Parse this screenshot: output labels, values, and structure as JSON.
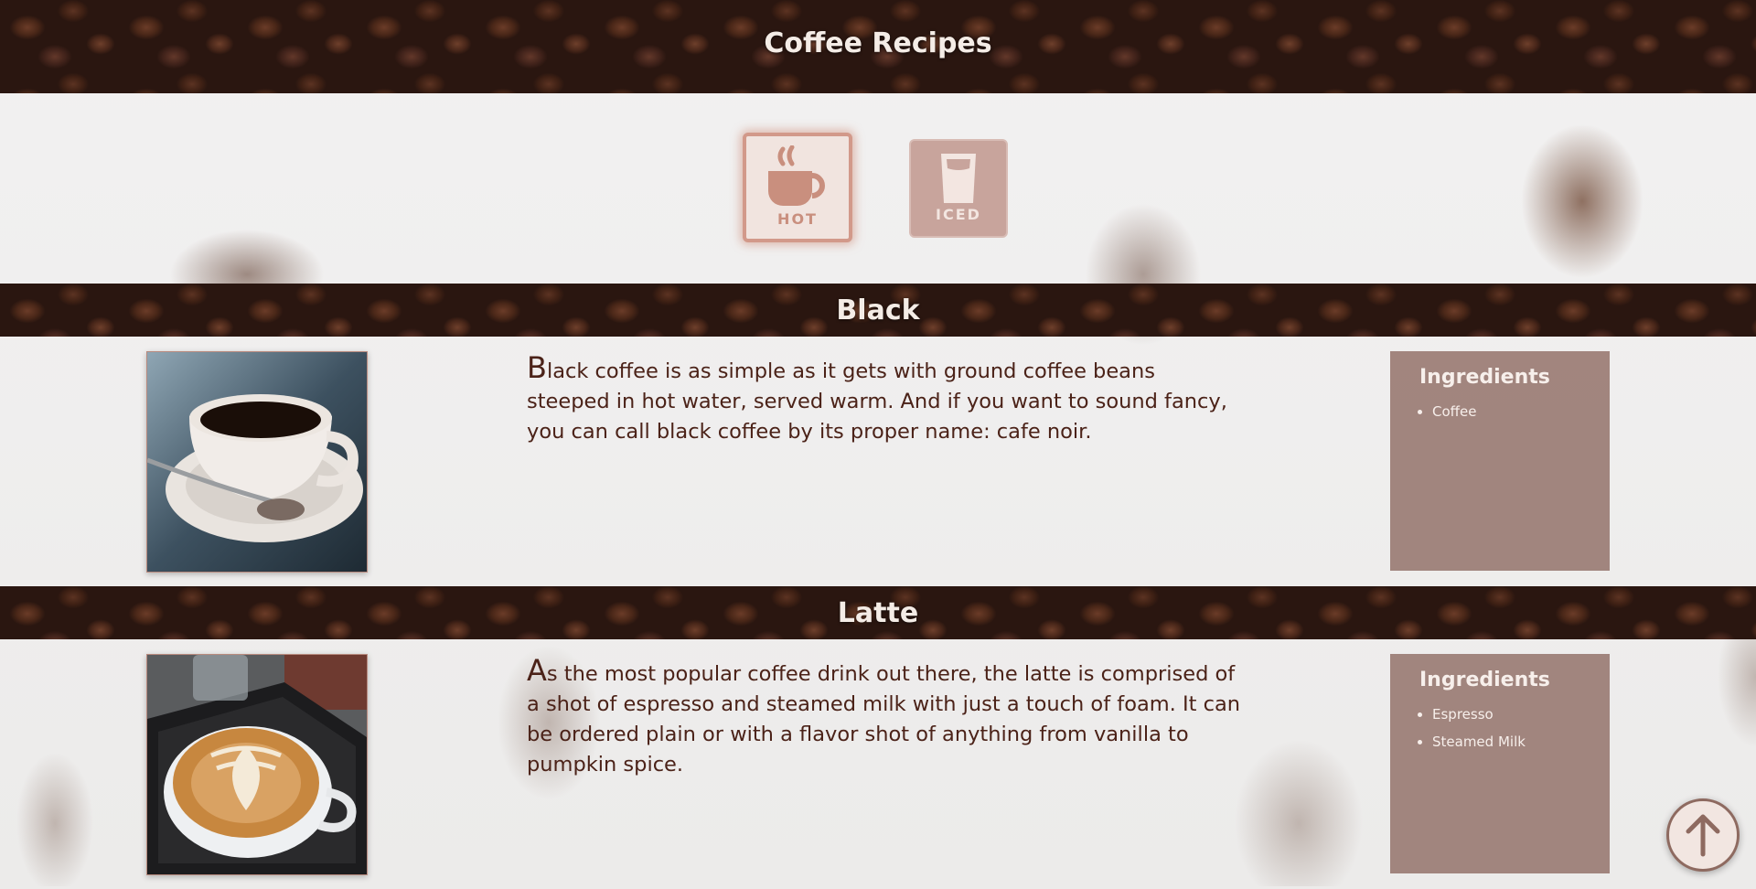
{
  "header": {
    "title": "Coffee Recipes"
  },
  "selector": {
    "hot_label": "HOT",
    "iced_label": "ICED",
    "hot_icon": "hot-cup-icon",
    "iced_icon": "iced-glass-icon"
  },
  "recipes": [
    {
      "name": "Black",
      "description_first_letter": "B",
      "description_rest": "lack coffee is as simple as it gets with ground coffee beans steeped in hot water, served warm. And if you want to sound fancy, you can call black coffee by its proper name: cafe noir.",
      "ingredients_heading": "Ingredients",
      "ingredients": [
        "Coffee"
      ]
    },
    {
      "name": "Latte",
      "description_first_letter": "A",
      "description_rest": "s the most popular coffee drink out there, the latte is comprised of a shot of espresso and steamed milk with just a touch of foam. It can be ordered plain or with a flavor shot of anything from vanilla to pumpkin spice.",
      "ingredients_heading": "Ingredients",
      "ingredients": [
        "Espresso",
        "Steamed Milk"
      ]
    }
  ],
  "colors": {
    "accent": "#d2998a",
    "text": "#4b2218",
    "ingredients_panel": "#96766e",
    "band": "#2a1610"
  },
  "scroll_top_icon": "arrow-up-icon"
}
